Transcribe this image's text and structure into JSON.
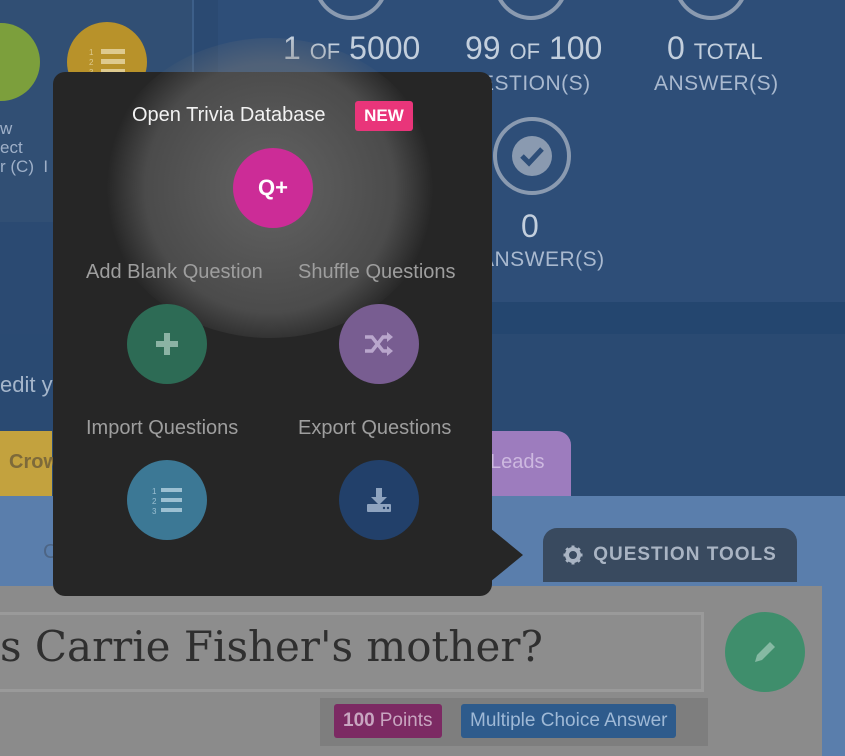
{
  "background": {
    "left_panel": {
      "caption_lines": [
        "w",
        "ect",
        "r (C)  I"
      ]
    },
    "stats": {
      "question_index": {
        "current": "1",
        "of_word": "OF",
        "total": "5000"
      },
      "questions_count": {
        "count": "99",
        "of_word": "OF",
        "max": "100",
        "caption": "ESTION(S)"
      },
      "total_answers": {
        "count": "0",
        "caption": "TOTAL",
        "caption2": "ANSWER(S)"
      },
      "correct_answers": {
        "count": "0",
        "caption": "ANSWER(S)"
      }
    },
    "edit_hint": "edit y",
    "tabs": {
      "yellow_label": "Crow",
      "purple_label": "Leads"
    },
    "ghost_letter": "C",
    "question_tools_label": "QUESTION TOOLS",
    "question": {
      "text": "s Carrie Fisher's mother?",
      "points_value": "100",
      "points_word": "Points",
      "type": "Multiple Choice Answer"
    }
  },
  "popover": {
    "open_db_label": "Open Trivia Database",
    "new_badge": "NEW",
    "open_db_icon": "Q+",
    "add_blank_label": "Add Blank Question",
    "shuffle_label": "Shuffle Questions",
    "import_label": "Import Questions",
    "export_label": "Export Questions",
    "icons": {
      "add": "plus-icon",
      "shuffle": "shuffle-icon",
      "import": "numbered-list-icon",
      "export": "download-icon"
    }
  },
  "colors": {
    "new_badge": "#e9357a",
    "open_db": "#cc2c97",
    "add": "#2d6b55",
    "shuffle": "#785d91",
    "import": "#3c7895",
    "export": "#22406a",
    "popover_bg": "#262626"
  }
}
